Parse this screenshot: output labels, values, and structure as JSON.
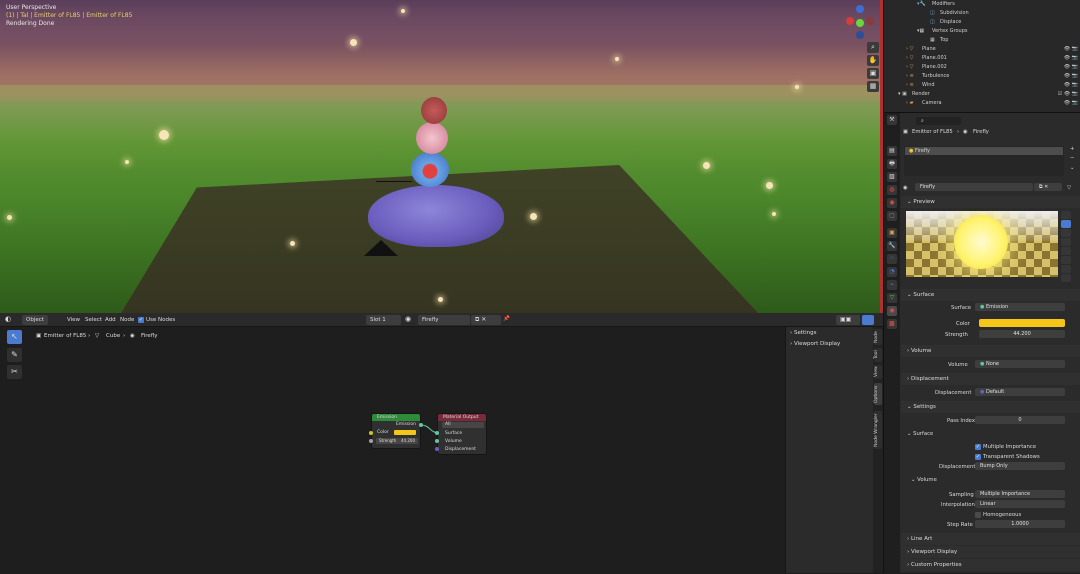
{
  "viewport": {
    "perspective_label": "User Perspective",
    "collection_label": "(1) | Tal | Emitter of FL85 | Emitter of FL85",
    "status_label": "Rendering Done"
  },
  "outliner": {
    "rows": [
      {
        "label": "Modifiers"
      },
      {
        "label": "Subdivision"
      },
      {
        "label": "Displace"
      },
      {
        "label": "Vertex Groups"
      },
      {
        "label": "Top"
      },
      {
        "label": "Plane"
      },
      {
        "label": "Plane.001"
      },
      {
        "label": "Plane.002"
      },
      {
        "label": "Turbulence"
      },
      {
        "label": "Wind"
      },
      {
        "label": "Render"
      },
      {
        "label": "Camera"
      }
    ]
  },
  "node_header": {
    "mode": "Object",
    "menus": [
      "View",
      "Select",
      "Add",
      "Node"
    ],
    "use_nodes": "Use Nodes",
    "slot": "Slot 1",
    "material": "Firefly"
  },
  "breadcrumb": [
    "Emitter of FL85",
    "Cube",
    "Firefly"
  ],
  "nodes": {
    "emission": {
      "title": "Emission",
      "output": "Emission",
      "color_label": "Color",
      "strength_label": "Strength",
      "strength_value": "44.200",
      "color": "#f5c518"
    },
    "material_output": {
      "title": "Material Output",
      "target": "All",
      "inputs": [
        "Surface",
        "Volume",
        "Displacement"
      ]
    }
  },
  "node_sidebar": {
    "items": [
      "Settings",
      "Viewport Display"
    ],
    "tabs": [
      "Node",
      "Tool",
      "View",
      "Options",
      "Node Wrangler"
    ]
  },
  "properties": {
    "breadcrumb": [
      "Emitter of FL85",
      "Firefly"
    ],
    "material_slot": "Firefly",
    "material_name": "Firefly",
    "sections": {
      "preview": "Preview",
      "surface": "Surface",
      "volume": "Volume",
      "displacement": "Displacement",
      "settings": "Settings",
      "line_art": "Line Art",
      "viewport_display": "Viewport Display",
      "custom_properties": "Custom Properties"
    },
    "surface": {
      "label": "Surface",
      "value": "Emission",
      "color_label": "Color",
      "strength_label": "Strength",
      "strength_value": "44.200"
    },
    "volume": {
      "label": "Volume",
      "value": "None"
    },
    "displacement": {
      "label": "Displacement",
      "value": "Default"
    },
    "settings": {
      "pass_index_label": "Pass Index",
      "pass_index_value": "0",
      "surface_sub": "Surface",
      "multiple_importance": "Multiple Importance",
      "transparent_shadows": "Transparent Shadows",
      "displacement_label": "Displacement",
      "displacement_value": "Bump Only",
      "volume_sub": "Volume",
      "sampling_label": "Sampling",
      "sampling_value": "Multiple Importance",
      "interpolation_label": "Interpolation",
      "interpolation_value": "Linear",
      "homogeneous": "Homogeneous",
      "step_rate_label": "Step Rate",
      "step_rate_value": "1.0000"
    }
  },
  "colors": {
    "accent": "#4a7bd0",
    "emission": "#f5c518",
    "link": "#5fc8a0"
  }
}
